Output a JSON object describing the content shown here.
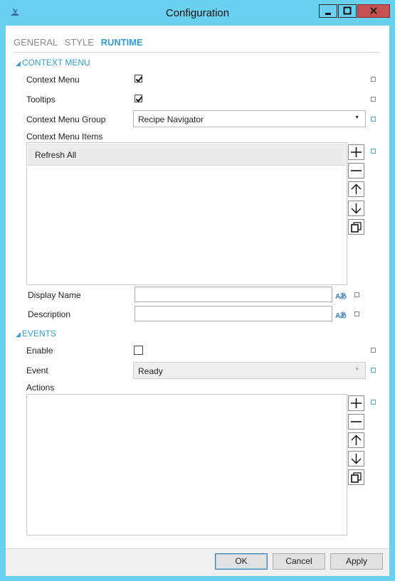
{
  "window": {
    "title": "Configuration",
    "icon": "app-icon",
    "buttons": [
      "minimize-icon",
      "maximize-icon",
      "close-icon"
    ]
  },
  "tabs": [
    {
      "label": "GENERAL",
      "active": false
    },
    {
      "label": "STYLE",
      "active": false
    },
    {
      "label": "RUNTIME",
      "active": true
    }
  ],
  "context_menu": {
    "header": "CONTEXT MENU",
    "context_menu_label": "Context Menu",
    "context_menu_checked": true,
    "tooltips_label": "Tooltips",
    "tooltips_checked": true,
    "group_label": "Context Menu Group",
    "group_value": "Recipe Navigator",
    "items_label": "Context Menu Items",
    "items": [
      "Refresh All"
    ],
    "display_name_label": "Display Name",
    "display_name_value": "",
    "description_label": "Description",
    "description_value": "",
    "translate_icon_text": "Aあ"
  },
  "events": {
    "header": "EVENTS",
    "enable_label": "Enable",
    "enable_checked": false,
    "event_label": "Event",
    "event_value": "Ready",
    "actions_label": "Actions",
    "actions": []
  },
  "footer": {
    "ok_label": "OK",
    "cancel_label": "Cancel",
    "apply_label": "Apply"
  },
  "colors": {
    "titlebar": "#6ad0ef",
    "accent": "#2f9fd4",
    "close": "#c75050"
  }
}
